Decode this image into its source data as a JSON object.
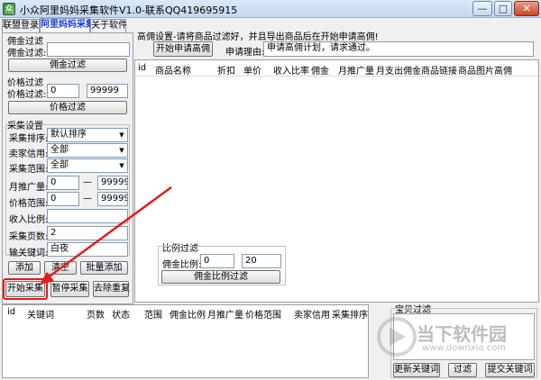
{
  "window": {
    "title": "小众阿里妈妈采集软件V1.0-联系QQ419695915",
    "min_label": "—",
    "max_label": "□",
    "close_label": "✕"
  },
  "tabs": [
    {
      "label": "联盟登录"
    },
    {
      "label": "阿里妈妈采集"
    },
    {
      "label": "关于软件"
    }
  ],
  "commission_filter": {
    "group_label": "佣金过滤",
    "field_label": "佣金过滤:",
    "value": "",
    "button": "佣金过滤"
  },
  "price_filter": {
    "group_label": "价格过滤",
    "field_label": "价格过滤:",
    "min": "0",
    "max": "99999",
    "button": "价格过滤"
  },
  "collect_settings": {
    "group_label": "采集设置",
    "sort_label": "采集排序:",
    "sort_value": "默认排序",
    "credit_label": "卖家信用:",
    "credit_value": "全部",
    "range_label": "采集范围:",
    "range_value": "全部",
    "monthly_label": "月推广量:",
    "monthly_min": "0",
    "monthly_max": "99999",
    "price_label": "价格范围:",
    "price_min": "0",
    "price_max": "99999",
    "ratio_label": "收入比例:",
    "ratio_value": "",
    "pages_label": "采集页数:",
    "pages_value": "2",
    "keyword_label": "输关键词:",
    "keyword_value": "白夜",
    "dash": "—"
  },
  "keyword_buttons": {
    "add": "添加",
    "clear": "清空",
    "batch_add": "批量添加"
  },
  "action_buttons": {
    "start": "开始采集",
    "pause": "暂停采集",
    "dedupe": "去除重复"
  },
  "high_commission": {
    "notice": "高佣设置-请将商品过滤好，并且导出商品后在开始申请高佣!",
    "apply_button": "开始申请高佣",
    "reason_label": "申请理由:",
    "reason_value": "申请高佣计划，请求通过。"
  },
  "product_table": {
    "columns": [
      "id",
      "商品名称",
      "折扣",
      "单价",
      "收入比率",
      "佣金",
      "月推广量",
      "月支出佣金",
      "商品链接",
      "商品图片",
      "高佣"
    ]
  },
  "ratio_filter": {
    "group_label": "比例过滤",
    "field_label": "佣金比例:",
    "min": "0",
    "max": "20",
    "button": "佣金比例过滤"
  },
  "keyword_table": {
    "columns": [
      "id",
      "关键词",
      "页数",
      "状态",
      "范围",
      "佣金比例",
      "月推广量",
      "价格范围",
      "卖家信用",
      "采集排序"
    ]
  },
  "baby_filter": {
    "group_label": "宝贝过滤",
    "update_button": "更新关键词",
    "filter_button": "过滤",
    "submit_button": "提交关键词"
  },
  "watermark": {
    "text": "当下软件园",
    "url": "www.downxia.com"
  },
  "colors": {
    "highlight_red": "#e41b1b",
    "tab_active": "#1a3adc"
  }
}
